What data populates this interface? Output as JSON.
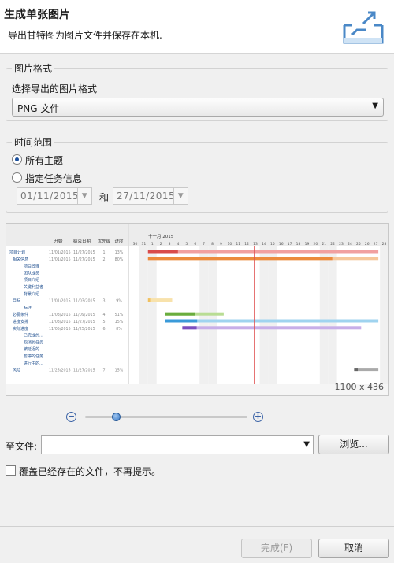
{
  "header": {
    "title": "生成单张图片",
    "description": "导出甘特图为图片文件并保存在本机."
  },
  "format": {
    "legend": "图片格式",
    "select_label": "选择导出的图片格式",
    "selected": "PNG 文件"
  },
  "time_range": {
    "legend": "时间范围",
    "all_topics": "所有主题",
    "specified": "指定任务信息",
    "start_date": "01/11/2015",
    "and": "和",
    "end_date": "27/11/2015"
  },
  "preview": {
    "dimensions": "1100 x 436",
    "header_cols": [
      "开始",
      "结束日期",
      "优先级",
      "进度"
    ],
    "month": "十一月 2015",
    "days": [
      "30",
      "31",
      "1",
      "2",
      "3",
      "4",
      "5",
      "6",
      "7",
      "8",
      "9",
      "10",
      "11",
      "12",
      "13",
      "14",
      "15",
      "16",
      "17",
      "18",
      "19",
      "20",
      "21",
      "22",
      "23",
      "24",
      "25",
      "26",
      "27",
      "28"
    ],
    "rows": [
      {
        "name": "项目计划",
        "start": "11/01/2015",
        "end": "11/27/2015",
        "priority": "1",
        "progress": "13%"
      },
      {
        "name": "相关信息",
        "start": "11/01/2015",
        "end": "11/27/2015",
        "priority": "2",
        "progress": "80%"
      },
      {
        "name": "项目经理",
        "start": "",
        "end": "",
        "priority": "",
        "progress": ""
      },
      {
        "name": "团队成员",
        "start": "",
        "end": "",
        "priority": "",
        "progress": ""
      },
      {
        "name": "项目介绍",
        "start": "",
        "end": "",
        "priority": "",
        "progress": ""
      },
      {
        "name": "关键利益者",
        "start": "",
        "end": "",
        "priority": "",
        "progress": ""
      },
      {
        "name": "背景介绍",
        "start": "",
        "end": "",
        "priority": "",
        "progress": ""
      },
      {
        "name": "目标",
        "start": "11/01/2015",
        "end": "11/03/2015",
        "priority": "3",
        "progress": "9%"
      },
      {
        "name": "标注",
        "start": "",
        "end": "",
        "priority": "",
        "progress": ""
      },
      {
        "name": "必要条件",
        "start": "11/03/2015",
        "end": "11/09/2015",
        "priority": "4",
        "progress": "51%"
      },
      {
        "name": "进度安排",
        "start": "11/03/2015",
        "end": "11/27/2015",
        "priority": "5",
        "progress": "15%"
      },
      {
        "name": "实际进度",
        "start": "11/05/2015",
        "end": "11/25/2015",
        "priority": "6",
        "progress": "8%"
      },
      {
        "name": "已完成的...",
        "start": "",
        "end": "",
        "priority": "",
        "progress": ""
      },
      {
        "name": "取消的任务",
        "start": "",
        "end": "",
        "priority": "",
        "progress": ""
      },
      {
        "name": "被延迟的...",
        "start": "",
        "end": "",
        "priority": "",
        "progress": ""
      },
      {
        "name": "暂停的任务",
        "start": "",
        "end": "",
        "priority": "",
        "progress": ""
      },
      {
        "name": "进行中的...",
        "start": "",
        "end": "",
        "priority": "",
        "progress": ""
      },
      {
        "name": "风险",
        "start": "11/25/2015",
        "end": "11/27/2015",
        "priority": "7",
        "progress": "15%"
      }
    ]
  },
  "zoom": {
    "level": 0.19
  },
  "file": {
    "label": "至文件:",
    "value": "",
    "browse": "浏览..."
  },
  "overwrite": {
    "label": "覆盖已经存在的文件，不再提示。"
  },
  "buttons": {
    "finish": "完成(F)",
    "cancel": "取消"
  },
  "colors": {
    "accent": "#1a4f9c",
    "today_line": "#e05050"
  }
}
